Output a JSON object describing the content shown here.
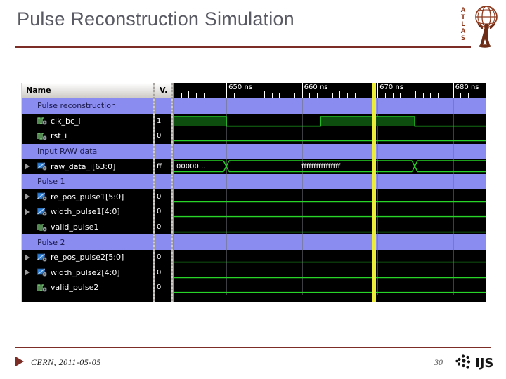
{
  "slide": {
    "title": "Pulse Reconstruction Simulation",
    "accent_color": "#7b2d26",
    "title_color": "#5a5a64"
  },
  "logos": {
    "atlas": {
      "name": "atlas-logo",
      "letters": [
        "A",
        "T",
        "L",
        "A",
        "S"
      ]
    },
    "ijs": {
      "name": "ijs-logo",
      "text": "IJS"
    }
  },
  "waveform_viewer": {
    "columns": {
      "name_header": "Name",
      "value_header": "V."
    },
    "rows": [
      {
        "label": "Pulse reconstruction",
        "type": "group",
        "value": "",
        "icon": "",
        "expandable": false,
        "wave": "none"
      },
      {
        "label": "clk_bc_i",
        "type": "signal",
        "value": "1",
        "icon": "clock-icon",
        "expandable": false,
        "wave": "clock"
      },
      {
        "label": "rst_i",
        "type": "signal",
        "value": "0",
        "icon": "clock-icon",
        "expandable": false,
        "wave": "low"
      },
      {
        "label": "Input RAW data",
        "type": "group",
        "value": "",
        "icon": "",
        "expandable": false,
        "wave": "none"
      },
      {
        "label": "raw_data_i[63:0]",
        "type": "signal",
        "value": "ff",
        "icon": "bus-icon",
        "expandable": true,
        "wave": "bus"
      },
      {
        "label": "Pulse 1",
        "type": "group",
        "value": "",
        "icon": "",
        "expandable": false,
        "wave": "none"
      },
      {
        "label": "re_pos_pulse1[5:0]",
        "type": "signal",
        "value": "0",
        "icon": "bus-icon",
        "expandable": true,
        "wave": "low"
      },
      {
        "label": "width_pulse1[4:0]",
        "type": "signal",
        "value": "0",
        "icon": "bus-icon",
        "expandable": true,
        "wave": "low"
      },
      {
        "label": "valid_pulse1",
        "type": "signal",
        "value": "0",
        "icon": "clock-icon",
        "expandable": false,
        "wave": "low"
      },
      {
        "label": "Pulse 2",
        "type": "group",
        "value": "",
        "icon": "",
        "expandable": false,
        "wave": "none"
      },
      {
        "label": "re_pos_pulse2[5:0]",
        "type": "signal",
        "value": "0",
        "icon": "bus-icon",
        "expandable": true,
        "wave": "low"
      },
      {
        "label": "width_pulse2[4:0]",
        "type": "signal",
        "value": "0",
        "icon": "bus-icon",
        "expandable": true,
        "wave": "low"
      },
      {
        "label": "valid_pulse2",
        "type": "signal",
        "value": "0",
        "icon": "clock-icon",
        "expandable": false,
        "wave": "low"
      }
    ],
    "time_axis": {
      "unit": "ns",
      "major_labels": [
        "650 ns",
        "660 ns",
        "670 ns",
        "680 ns"
      ],
      "major_times": [
        650,
        660,
        670,
        680
      ],
      "minor_tick_interval_ns": 1,
      "pixels_per_ns": 10.75,
      "origin_time_ns": 643.1
    },
    "cursor": {
      "time_ns": 669.3,
      "color": "#ecec3c"
    },
    "bus_segments": [
      {
        "label": "00000…",
        "start_ns": 643.1,
        "end_ns": 650.0
      },
      {
        "label": "ffffffffffffffff",
        "start_ns": 650.0,
        "end_ns": 675.0
      },
      {
        "label": "",
        "start_ns": 675.0,
        "end_ns": 686.5
      }
    ],
    "clock_edges_ns": [
      650.0,
      662.5,
      675.0
    ],
    "colors": {
      "group_row": "#8b8cf0",
      "signal_row": "#000000",
      "wave_line": "#27d427",
      "wave_fill": "#0d4d0d",
      "cursor": "#ecec3c",
      "grid": "#6f6f78"
    }
  },
  "footer": {
    "arrow": "play-triangle",
    "text": "CERN, 2011-05-05",
    "page_number": "30"
  }
}
